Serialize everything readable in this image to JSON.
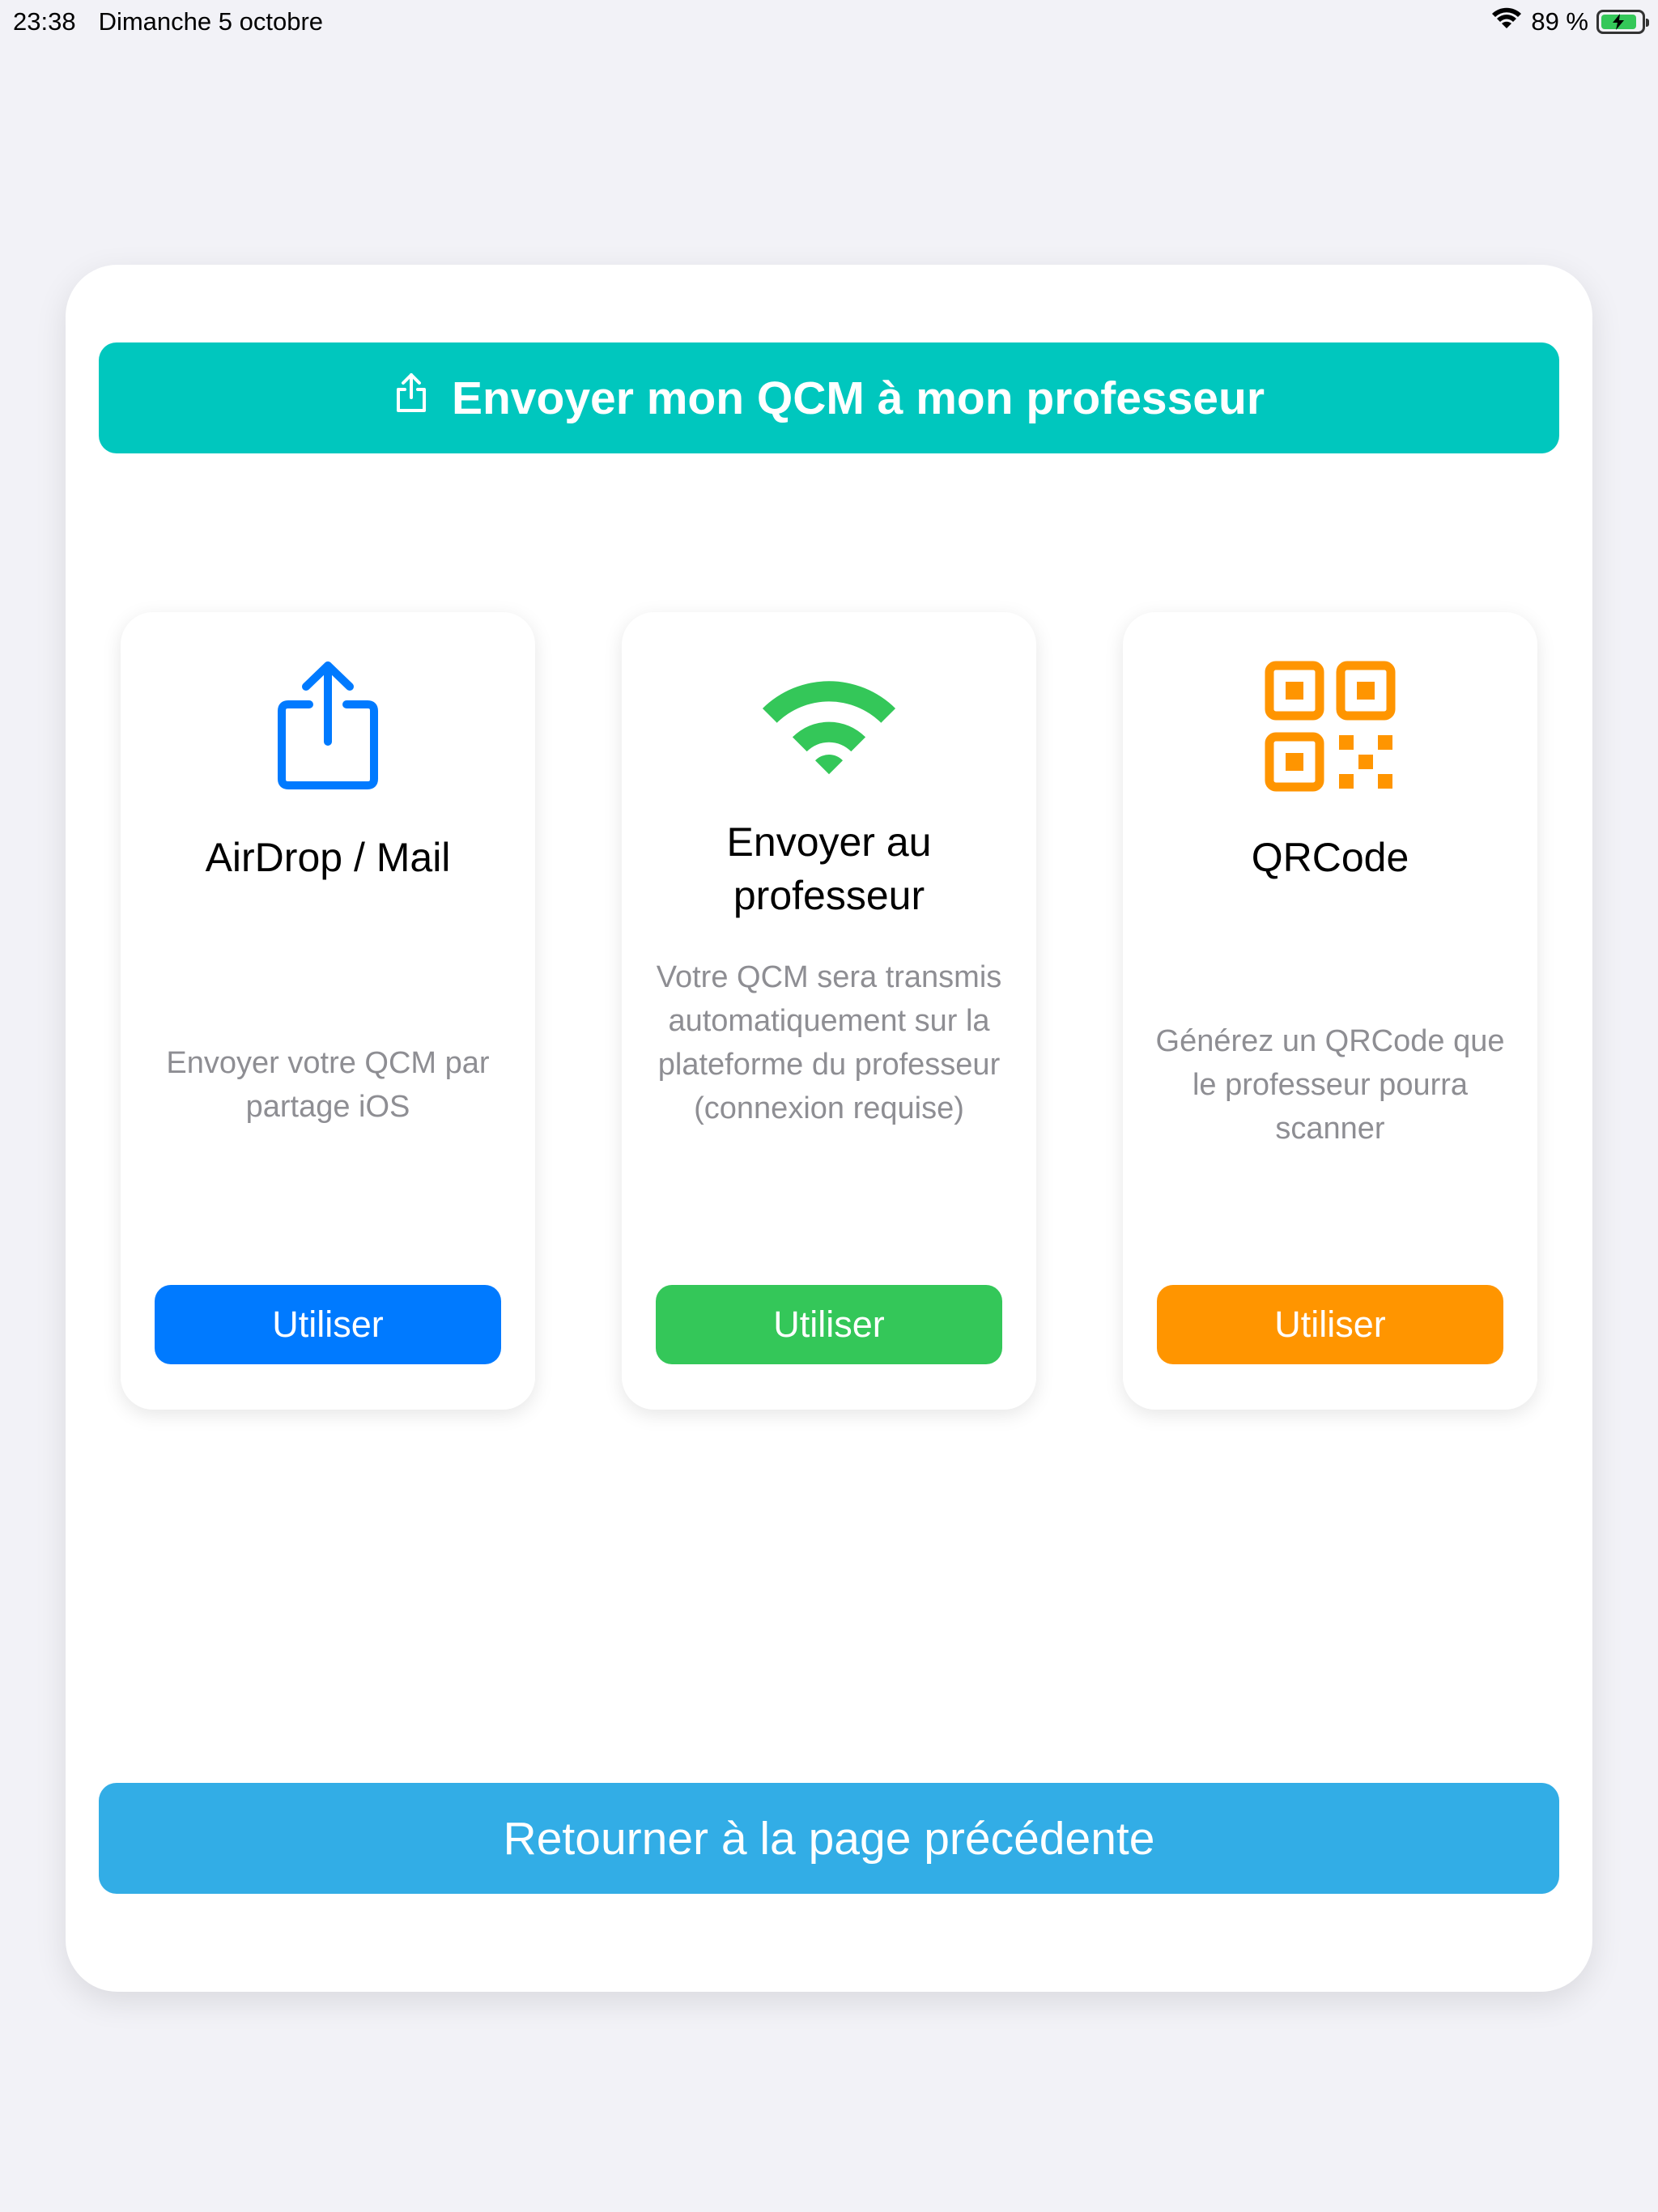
{
  "status_bar": {
    "time": "23:38",
    "date": "Dimanche 5 octobre",
    "battery": "89 %",
    "battery_level": 0.89,
    "wifi_icon": "wifi-icon",
    "battery_icon": "battery-charging-icon"
  },
  "header": {
    "icon": "share-icon",
    "label": "Envoyer mon QCM à mon professeur",
    "color": "#00c7be"
  },
  "cards": [
    {
      "icon": "share-icon",
      "title": "AirDrop / Mail",
      "description": "Envoyer votre QCM par partage iOS",
      "button": "Utiliser",
      "color": "#007aff"
    },
    {
      "icon": "wifi-icon",
      "title": "Envoyer au professeur",
      "description": "Votre QCM sera transmis automatiquement sur la plateforme du professeur (connexion requise)",
      "button": "Utiliser",
      "color": "#34c759"
    },
    {
      "icon": "qrcode-icon",
      "title": "QRCode",
      "description": "Générez un QRCode que le professeur pourra scanner",
      "button": "Utiliser",
      "color": "#ff9500"
    }
  ],
  "back_button": {
    "label": "Retourner à la page précédente",
    "color": "#32ade6"
  }
}
